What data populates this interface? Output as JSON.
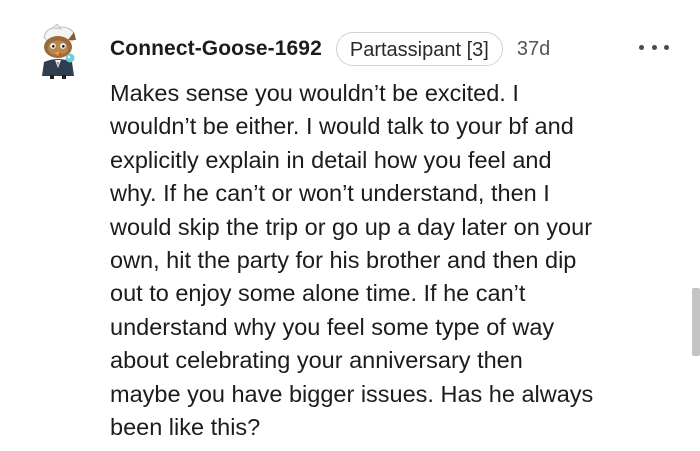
{
  "comment": {
    "username": "Connect-Goose-1692",
    "flair": "Partassipant [3]",
    "age": "37d",
    "body_lines": [
      "Makes sense you wouldn’t be excited. I",
      "wouldn’t be either. I would talk to your bf and",
      "explicitly explain in detail how you feel and",
      "why. If he can’t or won’t understand, then I",
      "would skip the trip or go up a day later on your",
      "own, hit the party for his brother and then dip",
      "out to enjoy some alone time. If he can’t",
      "understand why you feel some type of way",
      "about celebrating your anniversary then",
      "maybe you have bigger issues. Has he always",
      "been like this?"
    ]
  },
  "icons": {
    "avatar": "goose-avatar-icon",
    "more": "more-options-icon"
  },
  "colors": {
    "text": "#1c1c1c",
    "muted": "#555555",
    "flair_border": "#d2d2d2",
    "scrollbar": "#c4c4c4",
    "background": "#ffffff"
  }
}
